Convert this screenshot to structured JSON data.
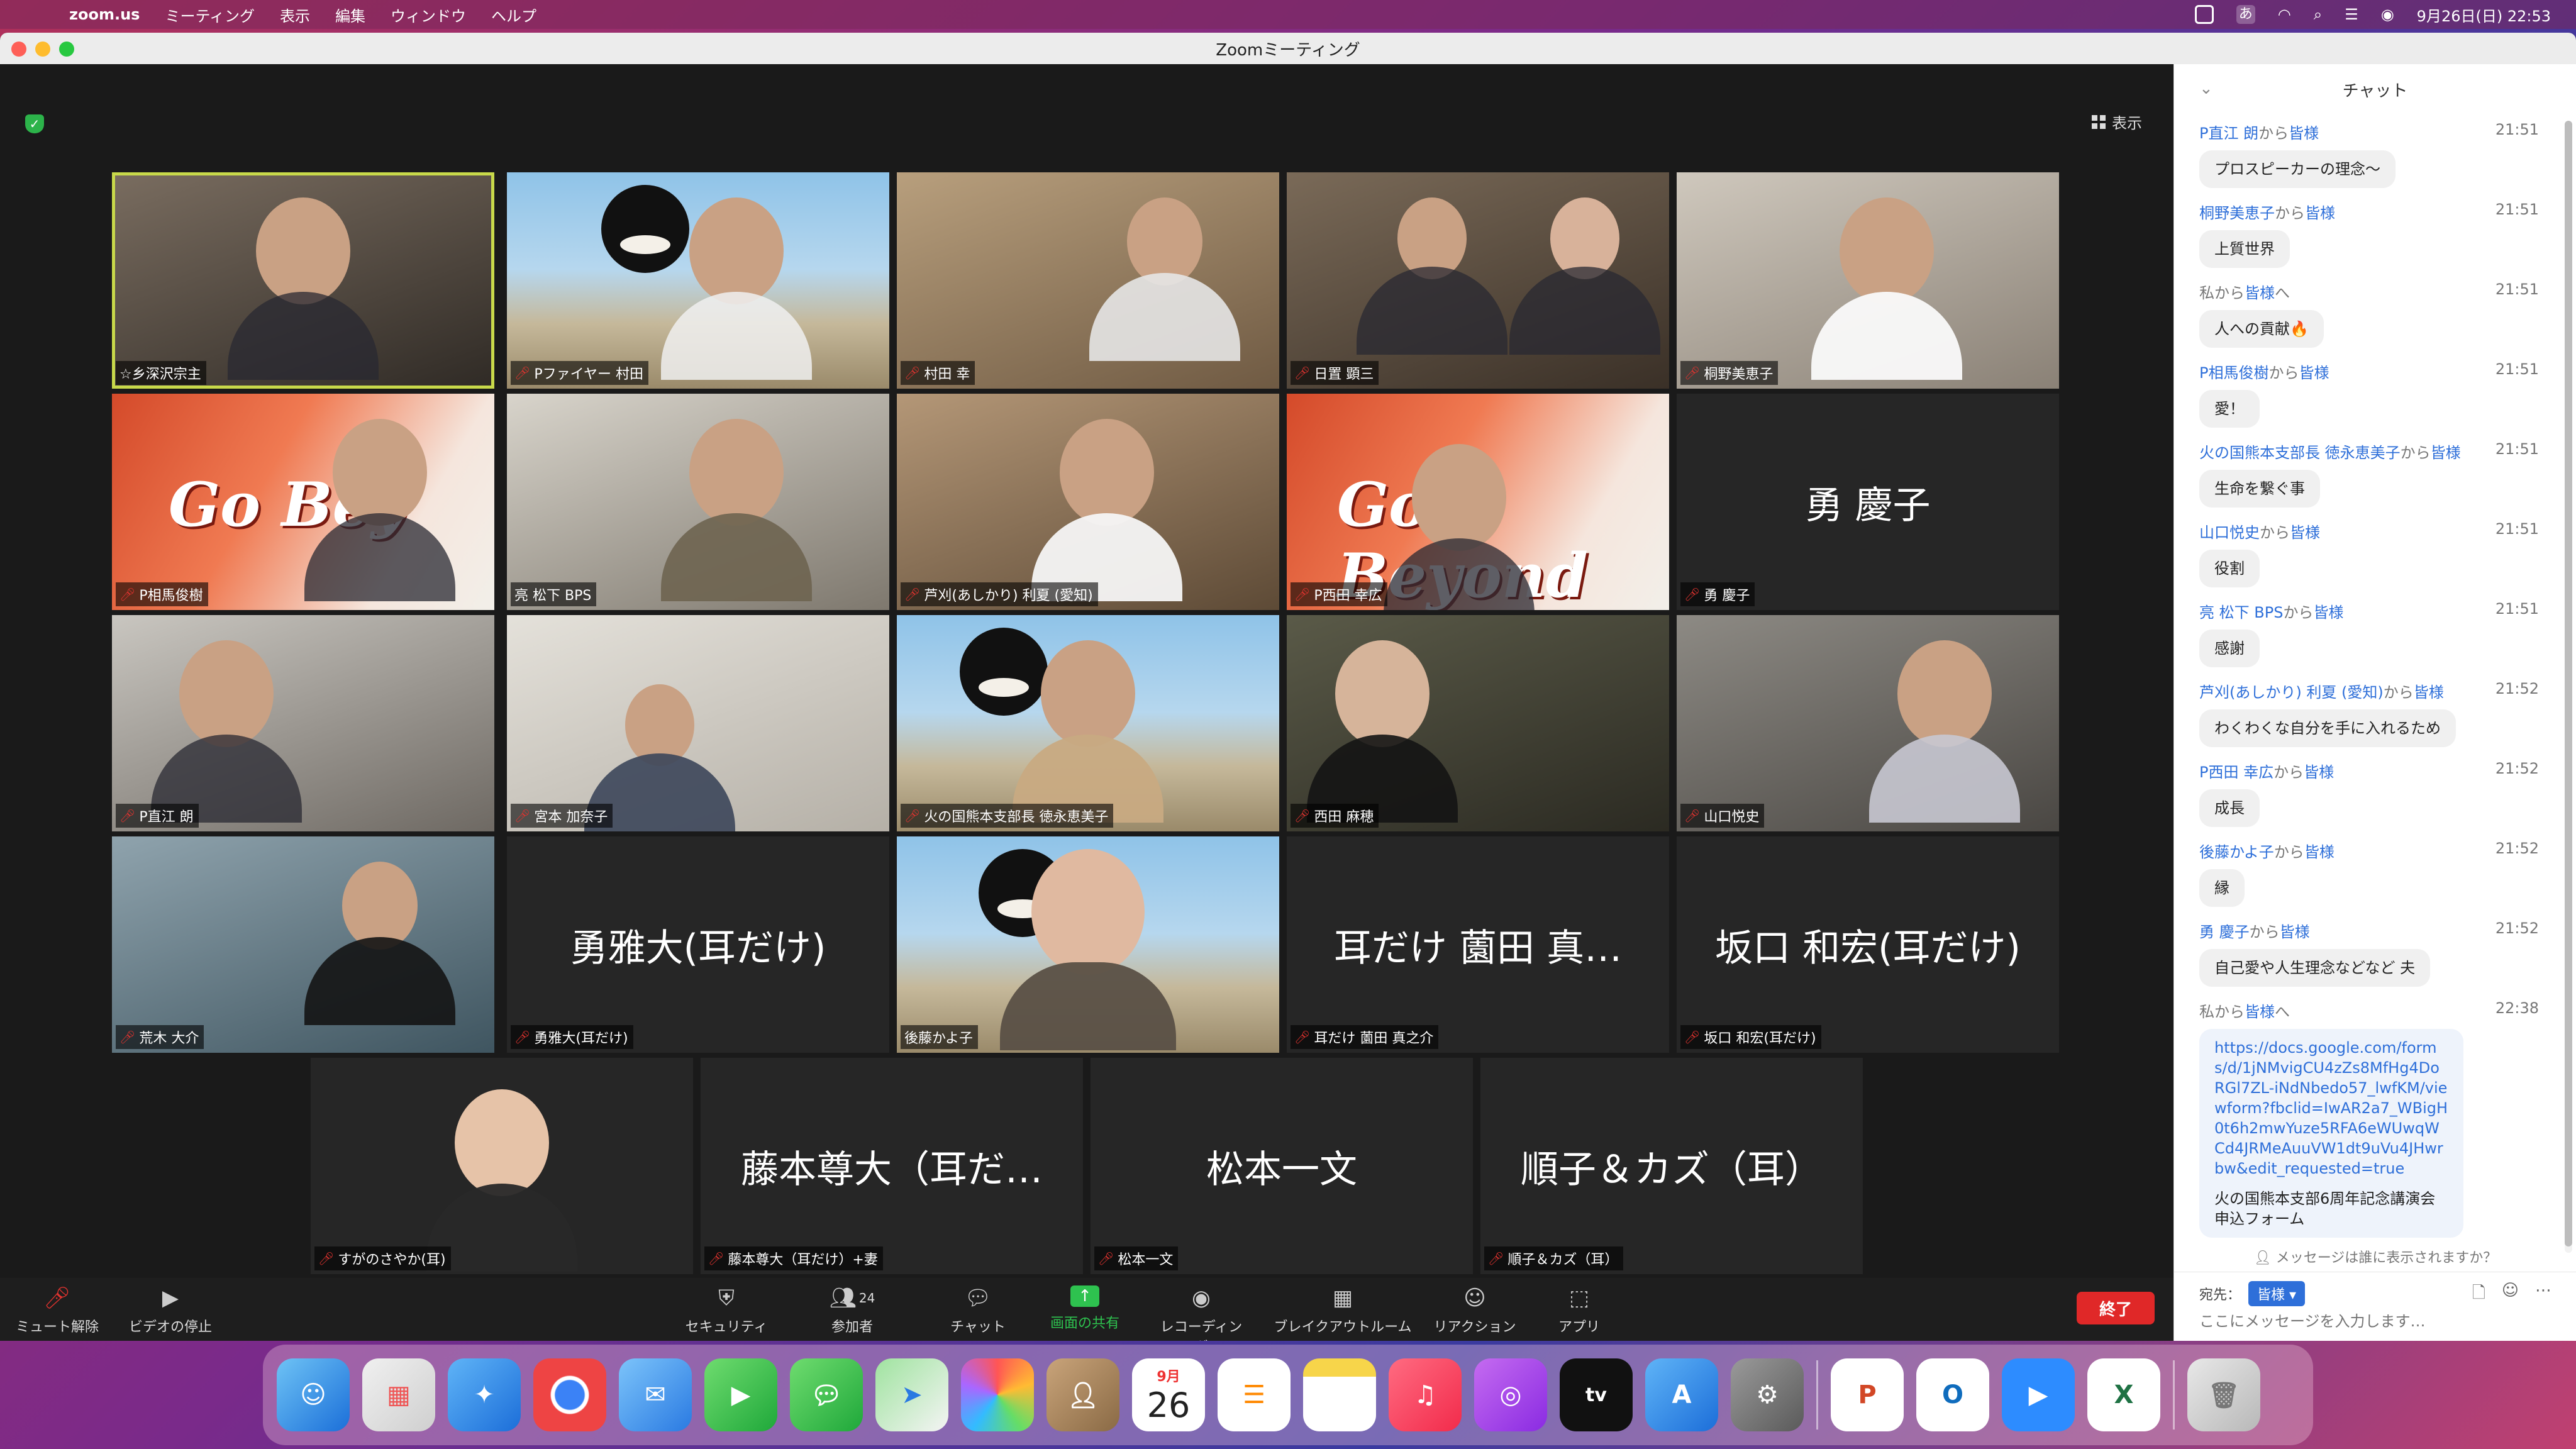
{
  "menubar": {
    "app": "zoom.us",
    "items": [
      "ミーティング",
      "表示",
      "編集",
      "ウィンドウ",
      "ヘルプ"
    ],
    "clock": "9月26日(日)  22:53",
    "ime": "あ"
  },
  "window": {
    "title": "Zoomミーティング"
  },
  "view_label": "表示",
  "participants": [
    {
      "name": "☆乡深沢宗主",
      "muted": false,
      "type": "video",
      "active": true
    },
    {
      "name": "Pファイヤー 村田",
      "muted": true,
      "type": "video"
    },
    {
      "name": "村田 幸",
      "muted": true,
      "type": "video"
    },
    {
      "name": "日置  顕三",
      "muted": true,
      "type": "video"
    },
    {
      "name": "桐野美恵子",
      "muted": true,
      "type": "video"
    },
    {
      "name": "P相馬俊樹",
      "muted": true,
      "type": "video",
      "banner": "Go Bey"
    },
    {
      "name": "亮 松下  BPS",
      "muted": false,
      "type": "video"
    },
    {
      "name": "芦刈(あしかり) 利夏 (愛知)",
      "muted": true,
      "type": "video"
    },
    {
      "name": "P西田 幸広",
      "muted": true,
      "type": "video",
      "banner": "Go Beyond"
    },
    {
      "name": "勇 慶子",
      "muted": true,
      "type": "name",
      "display": "勇 慶子"
    },
    {
      "name": "P直江 朗",
      "muted": true,
      "type": "video"
    },
    {
      "name": "宮本 加奈子",
      "muted": true,
      "type": "video"
    },
    {
      "name": "火の国熊本支部長  徳永恵美子",
      "muted": true,
      "type": "video"
    },
    {
      "name": "西田 麻穂",
      "muted": true,
      "type": "video"
    },
    {
      "name": "山口悦史",
      "muted": true,
      "type": "video"
    },
    {
      "name": "荒木  大介",
      "muted": true,
      "type": "video"
    },
    {
      "name": "勇雅大(耳だけ)",
      "muted": true,
      "type": "name",
      "display": "勇雅大(耳だけ)"
    },
    {
      "name": "後藤かよ子",
      "muted": false,
      "type": "video"
    },
    {
      "name": "耳だけ  薗田 真之介",
      "muted": true,
      "type": "name",
      "display": "耳だけ   薗田 真…"
    },
    {
      "name": "坂口 和宏(耳だけ)",
      "muted": true,
      "type": "name",
      "display": "坂口 和宏(耳だけ)"
    },
    {
      "name": "すがのさやか(耳)",
      "muted": true,
      "type": "video"
    },
    {
      "name": "藤本尊大（耳だけ）+妻",
      "muted": true,
      "type": "name",
      "display": "藤本尊大（耳だ…"
    },
    {
      "name": "松本一文",
      "muted": true,
      "type": "name",
      "display": "松本一文"
    },
    {
      "name": "順子＆カズ（耳）",
      "muted": true,
      "type": "name",
      "display": "順子＆カズ（耳）"
    }
  ],
  "toolbar": {
    "unmute": "ミュート解除",
    "stop_video": "ビデオの停止",
    "security": "セキュリティ",
    "participants": "参加者",
    "participants_count": "24",
    "chat": "チャット",
    "share": "画面の共有",
    "record": "レコーディング",
    "breakout": "ブレイクアウトルーム",
    "reactions": "リアクション",
    "apps": "アプリ",
    "end": "終了"
  },
  "chat": {
    "title": "チャット",
    "messages": [
      {
        "sender": "P直江 朗",
        "to": "皆様",
        "time": "21:51",
        "text": "プロスピーカーの理念〜"
      },
      {
        "sender": "桐野美恵子",
        "to": "皆様",
        "time": "21:51",
        "text": "上質世界"
      },
      {
        "sender": "私",
        "to": "皆様",
        "time": "21:51",
        "text": "人への貢献🔥",
        "self": true
      },
      {
        "sender": "P相馬俊樹",
        "to": "皆様",
        "time": "21:51",
        "text": "愛！"
      },
      {
        "sender": "火の国熊本支部長  徳永恵美子",
        "to": "皆様",
        "time": "21:51",
        "text": "生命を繋ぐ事"
      },
      {
        "sender": "山口悦史",
        "to": "皆様",
        "time": "21:51",
        "text": "役割"
      },
      {
        "sender": "亮 松下  BPS",
        "to": "皆様",
        "time": "21:51",
        "text": "感謝"
      },
      {
        "sender": "芦刈(あしかり) 利夏 (愛知)",
        "to": "皆様",
        "time": "21:52",
        "text": "わくわくな自分を手に入れるため"
      },
      {
        "sender": "P西田 幸広",
        "to": "皆様",
        "time": "21:52",
        "text": "成長"
      },
      {
        "sender": "後藤かよ子",
        "to": "皆様",
        "time": "21:52",
        "text": "縁"
      },
      {
        "sender": "勇 慶子",
        "to": "皆様",
        "time": "21:52",
        "text": "自己愛や人生理念などなど  夫"
      },
      {
        "sender": "私",
        "to": "皆様",
        "time": "22:38",
        "self": true,
        "link": "https://docs.google.com/forms/d/1jNMvigCU4zZs8MfHg4DoRGl7ZL-iNdNbedo57_lwfKM/viewform?fbclid=IwAR2a7_WBigH0t6h2mwYuze5RFA6eWUwqWCd4JRMeAuuVW1dt9uVu4JHwrbw&edit_requested=true",
        "text": "火の国熊本支部6周年記念講演会申込フォーム"
      }
    ],
    "from_word": "から",
    "to_word": "へ",
    "who_sees": "メッセージは誰に表示されますか？",
    "to_label": "宛先：",
    "to_value": "皆様",
    "input_placeholder": "ここにメッセージを入力します…"
  },
  "dock": {
    "calendar_month": "9月",
    "calendar_day": "26",
    "apps": [
      "finder-icon",
      "launchpad-icon",
      "safari-icon",
      "chrome-icon",
      "mail-icon",
      "facetime-icon",
      "messages-icon",
      "maps-icon",
      "photos-icon",
      "contacts-icon",
      "calendar-icon",
      "reminders-icon",
      "notes-icon",
      "music-icon",
      "podcasts-icon",
      "tv-icon",
      "appstore-icon",
      "settings-icon",
      "powerpoint-icon",
      "outlook-icon",
      "zoom-icon",
      "excel-icon",
      "trash-icon"
    ]
  }
}
